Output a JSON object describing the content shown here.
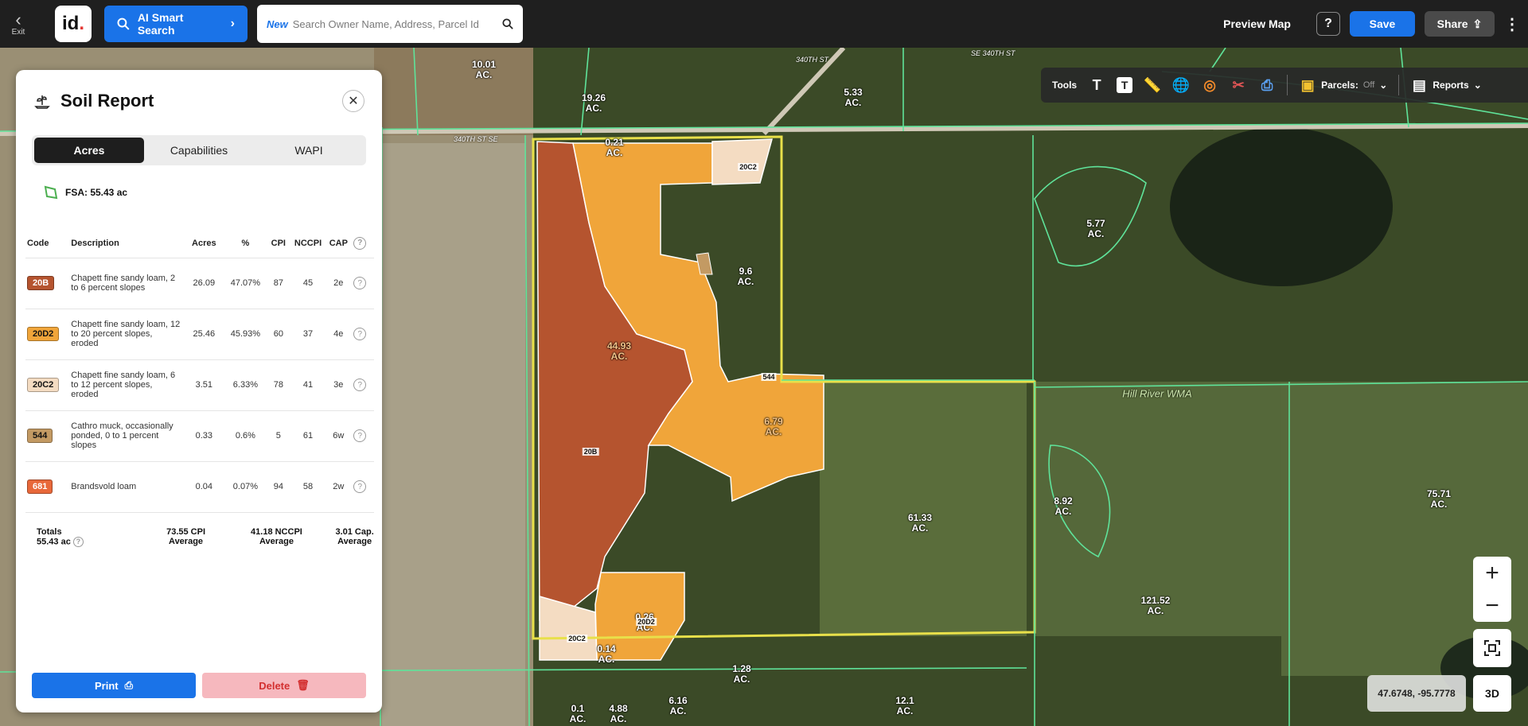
{
  "topbar": {
    "exit_label": "Exit",
    "logo_text": "id",
    "ai_search_label": "AI Smart Search",
    "search_new_tag": "New",
    "search_placeholder": "Search Owner Name, Address, Parcel Id",
    "preview_map_label": "Preview Map",
    "help_label": "?",
    "save_label": "Save",
    "share_label": "Share"
  },
  "tools": {
    "label": "Tools",
    "parcels_label": "Parcels:",
    "parcels_state": "Off",
    "reports_label": "Reports"
  },
  "panel": {
    "title": "Soil Report",
    "tabs": [
      {
        "label": "Acres",
        "active": true
      },
      {
        "label": "Capabilities",
        "active": false
      },
      {
        "label": "WAPI",
        "active": false
      }
    ],
    "fsa_label": "FSA: 55.43 ac",
    "columns": [
      "Code",
      "Description",
      "Acres",
      "%",
      "CPI",
      "NCCPI",
      "CAP"
    ],
    "rows": [
      {
        "code": "20B",
        "color": "#b5542f",
        "text_color": "#fff",
        "description": "Chapett fine sandy loam, 2 to 6 percent slopes",
        "acres": "26.09",
        "pct": "47.07%",
        "cpi": "87",
        "nccpi": "45",
        "cap": "2e"
      },
      {
        "code": "20D2",
        "color": "#f0a53a",
        "text_color": "#111",
        "description": "Chapett fine sandy loam, 12 to 20 percent slopes, eroded",
        "acres": "25.46",
        "pct": "45.93%",
        "cpi": "60",
        "nccpi": "37",
        "cap": "4e"
      },
      {
        "code": "20C2",
        "color": "#f4dcc2",
        "text_color": "#111",
        "description": "Chapett fine sandy loam, 6 to 12 percent slopes, eroded",
        "acres": "3.51",
        "pct": "6.33%",
        "cpi": "78",
        "nccpi": "41",
        "cap": "3e"
      },
      {
        "code": "544",
        "color": "#c39a63",
        "text_color": "#111",
        "description": "Cathro muck, occasionally ponded, 0 to 1 percent slopes",
        "acres": "0.33",
        "pct": "0.6%",
        "cpi": "5",
        "nccpi": "61",
        "cap": "6w"
      },
      {
        "code": "681",
        "color": "#e8683a",
        "text_color": "#fff",
        "description": "Brandsvold loam",
        "acres": "0.04",
        "pct": "0.07%",
        "cpi": "94",
        "nccpi": "58",
        "cap": "2w"
      }
    ],
    "totals": {
      "label": "Totals",
      "acres": "55.43 ac",
      "cpi": "73.55 CPI",
      "nccpi": "41.18 NCCPI",
      "cap": "3.01 Cap.",
      "avg": "Average"
    },
    "print_label": "Print",
    "delete_label": "Delete"
  },
  "map": {
    "road_labels": [
      "340TH ST SE",
      "340TH ST",
      "SE 340TH ST"
    ],
    "wma_label": "Hill River WMA",
    "acreage_labels": [
      {
        "text": "10.01\nAC."
      },
      {
        "text": "19.26\nAC."
      },
      {
        "text": "5.33\nAC."
      },
      {
        "text": "0.21\nAC."
      },
      {
        "text": "9.6\nAC."
      },
      {
        "text": "5.77\nAC."
      },
      {
        "text": "44.93\nAC."
      },
      {
        "text": "6.79\nAC."
      },
      {
        "text": "8.92\nAC."
      },
      {
        "text": "61.33\nAC."
      },
      {
        "text": "75.71\nAC."
      },
      {
        "text": "121.52\nAC."
      },
      {
        "text": "0.26\nAC."
      },
      {
        "text": "0.14\nAC."
      },
      {
        "text": "1.28\nAC."
      },
      {
        "text": "0.1\nAC."
      },
      {
        "text": "4.88\nAC."
      },
      {
        "text": "6.16\nAC."
      },
      {
        "text": "12.1\nAC."
      }
    ],
    "soil_codes": [
      "20C2",
      "544",
      "20B",
      "20D2",
      "20C2"
    ]
  },
  "controls": {
    "zoom_in": "+",
    "zoom_out": "−",
    "coords": "47.6748, -95.7778",
    "view3d": "3D"
  }
}
